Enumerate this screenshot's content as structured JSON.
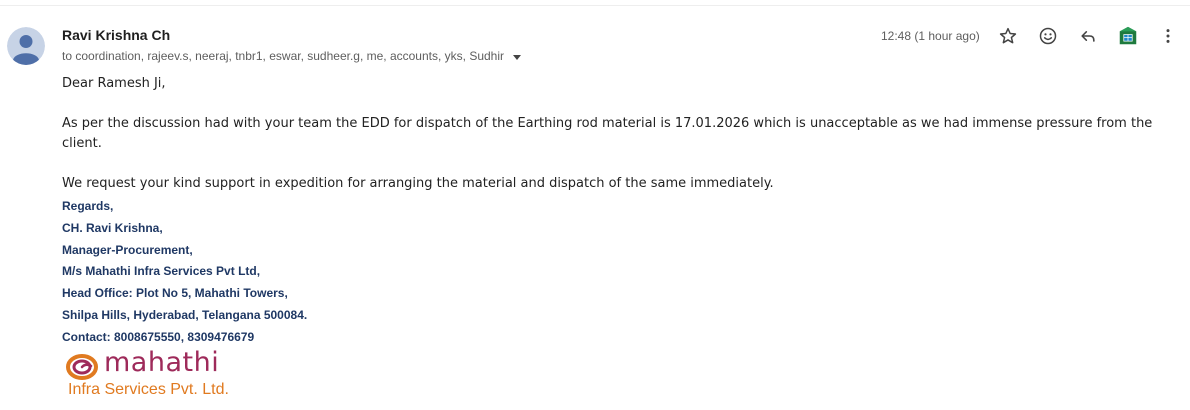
{
  "message": {
    "sender_name": "Ravi Krishna Ch",
    "recipients": "to coordination, rajeev.s, neeraj, tnbr1, eswar, sudheer.g, me, accounts, yks, Sudhir",
    "timestamp": "12:48 (1 hour ago)",
    "body": {
      "greeting": "Dear Ramesh Ji,",
      "paragraph_main": "As per the discussion had with your team the EDD for dispatch of the Earthing rod material is 17.01.2026 which is unacceptable as we had immense pressure from the client.",
      "paragraph_request": "We request your kind support in expedition for arranging the material and dispatch of the same immediately."
    },
    "signature": [
      "Regards,",
      "CH. Ravi Krishna,",
      "Manager-Procurement,",
      "M/s Mahathi Infra Services Pvt Ltd,",
      "Head Office: Plot No 5, Mahathi Towers,",
      "Shilpa Hills, Hyderabad, Telangana 500084.",
      "Contact: 8008675550, 8309476679"
    ],
    "logo": {
      "word": "mahathi",
      "subtitle": "Infra Services Pvt. Ltd."
    }
  },
  "actions": {
    "star_icon": "star-icon",
    "emoji_icon": "emoji-icon",
    "reply_icon": "reply-icon",
    "sheets_icon": "sheets-icon",
    "more_icon": "more-vert-icon"
  },
  "colors": {
    "signature": "#1f3864",
    "logo_word": "#9e2a5a",
    "logo_subtitle": "#e07a20",
    "avatar_bg": "#c7d3e6",
    "avatar_fg": "#4f6fa8"
  }
}
